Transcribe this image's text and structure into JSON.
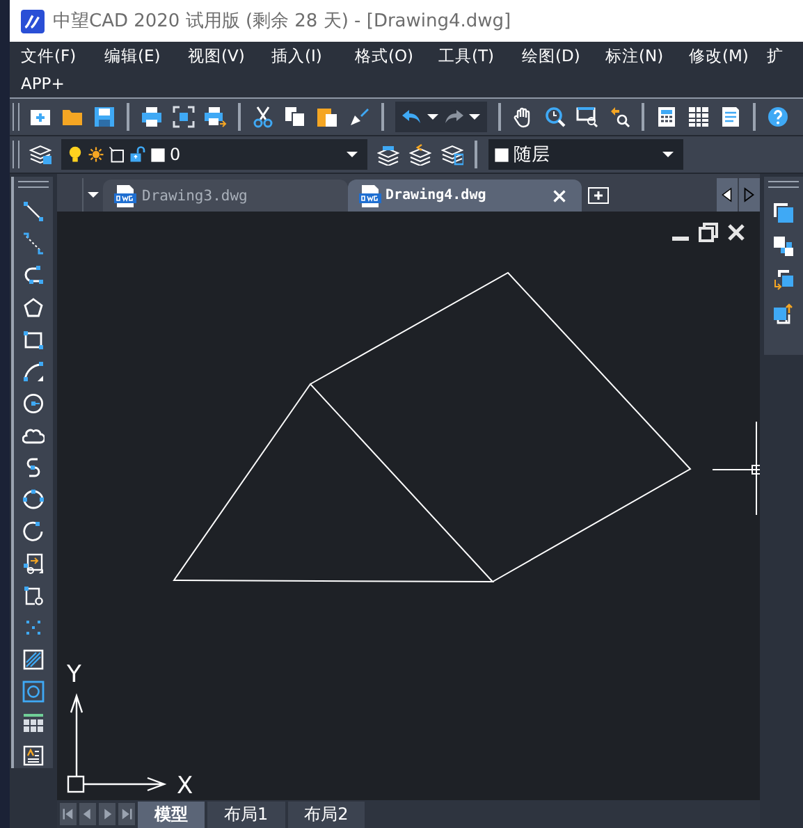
{
  "window": {
    "title": "中望CAD 2020 试用版 (剩余 28 天) - [Drawing4.dwg]"
  },
  "menu": [
    "文件(F)",
    "编辑(E)",
    "视图(V)",
    "插入(I)",
    "格式(O)",
    "工具(T)",
    "绘图(D)",
    "标注(N)",
    "修改(M)",
    "扩",
    "APP+"
  ],
  "layer_bar": {
    "layer": "0",
    "color_control": "随层"
  },
  "document_tabs": [
    {
      "label": "Drawing3.dwg",
      "selected": false
    },
    {
      "label": "Drawing4.dwg",
      "selected": true
    }
  ],
  "ucs": {
    "x_label": "X",
    "y_label": "Y"
  },
  "layout_tabs": [
    {
      "label": "模型",
      "selected": true
    },
    {
      "label": "布局1",
      "selected": false
    },
    {
      "label": "布局2",
      "selected": false
    }
  ]
}
